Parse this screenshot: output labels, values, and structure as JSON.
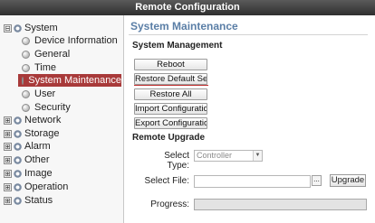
{
  "window": {
    "title": "Remote Configuration"
  },
  "sidebar": {
    "items": [
      {
        "label": "System",
        "toggle": "⊟"
      },
      {
        "label": "Device Information"
      },
      {
        "label": "General"
      },
      {
        "label": "Time"
      },
      {
        "label": "System Maintenance"
      },
      {
        "label": "User"
      },
      {
        "label": "Security"
      },
      {
        "label": "Network",
        "toggle": "⊞"
      },
      {
        "label": "Storage",
        "toggle": "⊞"
      },
      {
        "label": "Alarm",
        "toggle": "⊞"
      },
      {
        "label": "Other",
        "toggle": "⊞"
      },
      {
        "label": "Image",
        "toggle": "⊞"
      },
      {
        "label": "Operation",
        "toggle": "⊞"
      },
      {
        "label": "Status",
        "toggle": "⊞"
      }
    ]
  },
  "main": {
    "title": "System Maintenance",
    "system_management": {
      "heading": "System Management",
      "buttons": [
        "Reboot",
        "Restore Default Setti...",
        "Restore All",
        "Import Configuration ...",
        "Export Configuration ..."
      ]
    },
    "remote_upgrade": {
      "heading": "Remote Upgrade",
      "select_type_label": "Select Type:",
      "select_type_value": "Controller Upgra...",
      "select_file_label": "Select File:",
      "browse_label": "...",
      "upgrade_label": "Upgrade",
      "progress_label": "Progress:",
      "progress_value": 0
    }
  }
}
